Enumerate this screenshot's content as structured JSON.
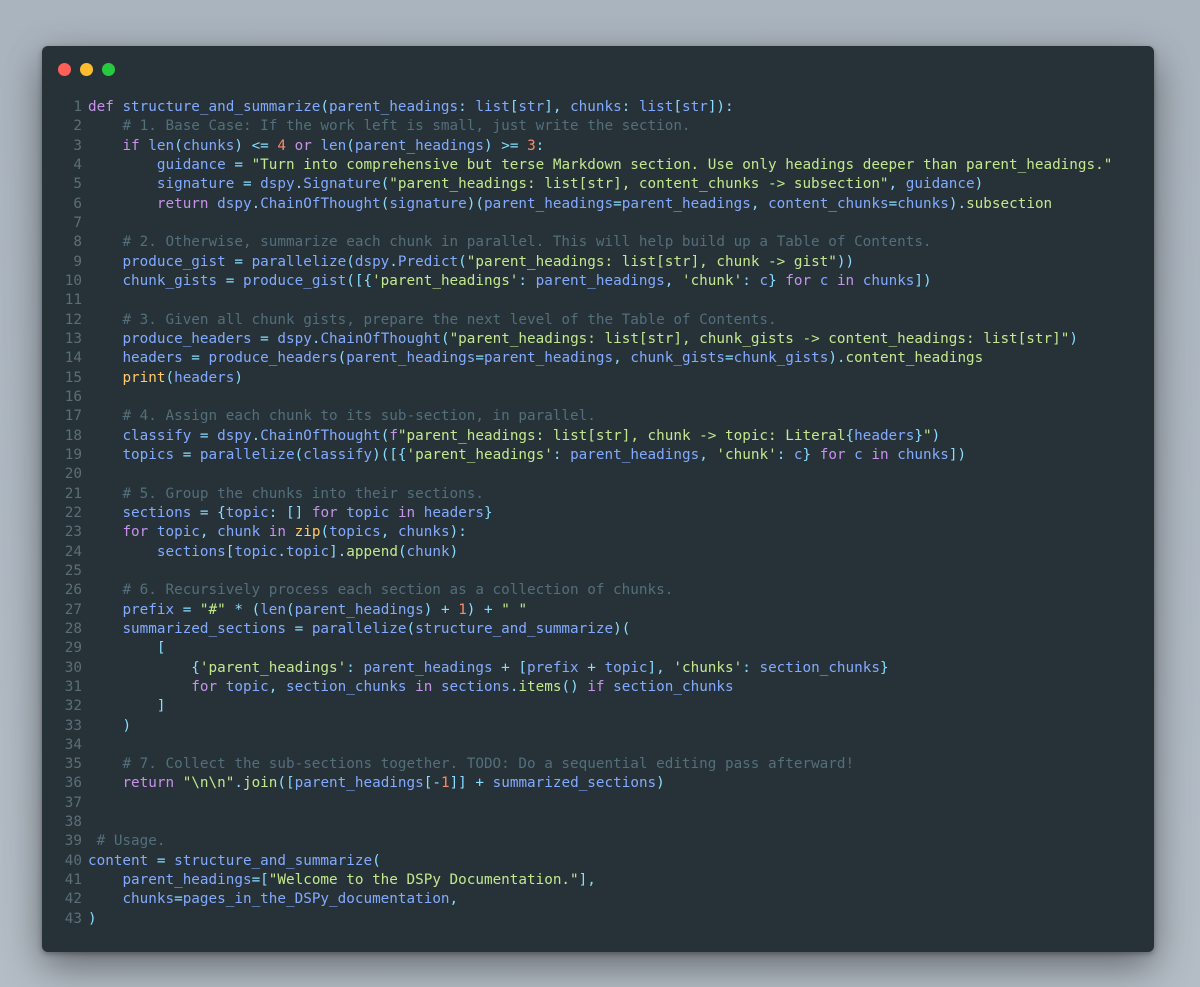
{
  "window": {
    "controls": [
      {
        "name": "close",
        "color": "#ff5f56"
      },
      {
        "name": "minimize",
        "color": "#ffbd2e"
      },
      {
        "name": "maximize",
        "color": "#27c93f"
      }
    ]
  },
  "code_lines": [
    [
      [
        "kw",
        "def "
      ],
      [
        "fn",
        "structure_and_summarize"
      ],
      [
        "pa",
        "("
      ],
      [
        "va",
        "parent_headings"
      ],
      [
        "op",
        ": "
      ],
      [
        "va",
        "list"
      ],
      [
        "pa",
        "["
      ],
      [
        "va",
        "str"
      ],
      [
        "pa",
        "], "
      ],
      [
        "va",
        "chunks"
      ],
      [
        "op",
        ": "
      ],
      [
        "va",
        "list"
      ],
      [
        "pa",
        "["
      ],
      [
        "va",
        "str"
      ],
      [
        "pa",
        "]):"
      ]
    ],
    [
      [
        "pl",
        "    "
      ],
      [
        "cm",
        "# 1. Base Case: If the work left is small, just write the section."
      ]
    ],
    [
      [
        "pl",
        "    "
      ],
      [
        "kw",
        "if "
      ],
      [
        "fn",
        "len"
      ],
      [
        "pa",
        "("
      ],
      [
        "va",
        "chunks"
      ],
      [
        "pa",
        ") "
      ],
      [
        "op",
        "<= "
      ],
      [
        "num",
        "4"
      ],
      [
        "kw",
        " or "
      ],
      [
        "fn",
        "len"
      ],
      [
        "pa",
        "("
      ],
      [
        "va",
        "parent_headings"
      ],
      [
        "pa",
        ") "
      ],
      [
        "op",
        ">= "
      ],
      [
        "num",
        "3"
      ],
      [
        "pa",
        ":"
      ]
    ],
    [
      [
        "pl",
        "        "
      ],
      [
        "va",
        "guidance"
      ],
      [
        "op",
        " = "
      ],
      [
        "str",
        "\"Turn into comprehensive but terse Markdown section. Use only headings deeper than parent_headings.\""
      ]
    ],
    [
      [
        "pl",
        "        "
      ],
      [
        "va",
        "signature"
      ],
      [
        "op",
        " = "
      ],
      [
        "va",
        "dspy"
      ],
      [
        "op",
        "."
      ],
      [
        "fn",
        "Signature"
      ],
      [
        "pa",
        "("
      ],
      [
        "str",
        "\"parent_headings: list[str], content_chunks -> subsection\""
      ],
      [
        "pa",
        ", "
      ],
      [
        "va",
        "guidance"
      ],
      [
        "pa",
        ")"
      ]
    ],
    [
      [
        "pl",
        "        "
      ],
      [
        "kw",
        "return "
      ],
      [
        "va",
        "dspy"
      ],
      [
        "op",
        "."
      ],
      [
        "fn",
        "ChainOfThought"
      ],
      [
        "pa",
        "("
      ],
      [
        "va",
        "signature"
      ],
      [
        "pa",
        ")("
      ],
      [
        "va",
        "parent_headings"
      ],
      [
        "op",
        "="
      ],
      [
        "va",
        "parent_headings"
      ],
      [
        "pa",
        ", "
      ],
      [
        "va",
        "content_chunks"
      ],
      [
        "op",
        "="
      ],
      [
        "va",
        "chunks"
      ],
      [
        "pa",
        ")."
      ],
      [
        "at",
        "subsection"
      ]
    ],
    [],
    [
      [
        "pl",
        "    "
      ],
      [
        "cm",
        "# 2. Otherwise, summarize each chunk in parallel. This will help build up a Table of Contents."
      ]
    ],
    [
      [
        "pl",
        "    "
      ],
      [
        "va",
        "produce_gist"
      ],
      [
        "op",
        " = "
      ],
      [
        "fn",
        "parallelize"
      ],
      [
        "pa",
        "("
      ],
      [
        "va",
        "dspy"
      ],
      [
        "op",
        "."
      ],
      [
        "fn",
        "Predict"
      ],
      [
        "pa",
        "("
      ],
      [
        "str",
        "\"parent_headings: list[str], chunk -> gist\""
      ],
      [
        "pa",
        "))"
      ]
    ],
    [
      [
        "pl",
        "    "
      ],
      [
        "va",
        "chunk_gists"
      ],
      [
        "op",
        " = "
      ],
      [
        "fn",
        "produce_gist"
      ],
      [
        "pa",
        "([{"
      ],
      [
        "str",
        "'parent_headings'"
      ],
      [
        "pa",
        ": "
      ],
      [
        "va",
        "parent_headings"
      ],
      [
        "pa",
        ", "
      ],
      [
        "str",
        "'chunk'"
      ],
      [
        "pa",
        ": "
      ],
      [
        "va",
        "c"
      ],
      [
        "pa",
        "} "
      ],
      [
        "kw",
        "for "
      ],
      [
        "va",
        "c "
      ],
      [
        "kw",
        "in "
      ],
      [
        "va",
        "chunks"
      ],
      [
        "pa",
        "])"
      ]
    ],
    [],
    [
      [
        "pl",
        "    "
      ],
      [
        "cm",
        "# 3. Given all chunk gists, prepare the next level of the Table of Contents."
      ]
    ],
    [
      [
        "pl",
        "    "
      ],
      [
        "va",
        "produce_headers"
      ],
      [
        "op",
        " = "
      ],
      [
        "va",
        "dspy"
      ],
      [
        "op",
        "."
      ],
      [
        "fn",
        "ChainOfThought"
      ],
      [
        "pa",
        "("
      ],
      [
        "str",
        "\"parent_headings: list[str], chunk_gists -> content_headings: list[str]\""
      ],
      [
        "pa",
        ")"
      ]
    ],
    [
      [
        "pl",
        "    "
      ],
      [
        "va",
        "headers"
      ],
      [
        "op",
        " = "
      ],
      [
        "fn",
        "produce_headers"
      ],
      [
        "pa",
        "("
      ],
      [
        "va",
        "parent_headings"
      ],
      [
        "op",
        "="
      ],
      [
        "va",
        "parent_headings"
      ],
      [
        "pa",
        ", "
      ],
      [
        "va",
        "chunk_gists"
      ],
      [
        "op",
        "="
      ],
      [
        "va",
        "chunk_gists"
      ],
      [
        "pa",
        ")."
      ],
      [
        "at",
        "content_headings"
      ]
    ],
    [
      [
        "pl",
        "    "
      ],
      [
        "ty",
        "print"
      ],
      [
        "pa",
        "("
      ],
      [
        "va",
        "headers"
      ],
      [
        "pa",
        ")"
      ]
    ],
    [],
    [
      [
        "pl",
        "    "
      ],
      [
        "cm",
        "# 4. Assign each chunk to its sub-section, in parallel."
      ]
    ],
    [
      [
        "pl",
        "    "
      ],
      [
        "va",
        "classify"
      ],
      [
        "op",
        " = "
      ],
      [
        "va",
        "dspy"
      ],
      [
        "op",
        "."
      ],
      [
        "fn",
        "ChainOfThought"
      ],
      [
        "pa",
        "("
      ],
      [
        "kw",
        "f"
      ],
      [
        "str",
        "\"parent_headings: list[str], chunk -> topic: Literal"
      ],
      [
        "op",
        "{"
      ],
      [
        "va",
        "headers"
      ],
      [
        "op",
        "}"
      ],
      [
        "str",
        "\""
      ],
      [
        "pa",
        ")"
      ]
    ],
    [
      [
        "pl",
        "    "
      ],
      [
        "va",
        "topics"
      ],
      [
        "op",
        " = "
      ],
      [
        "fn",
        "parallelize"
      ],
      [
        "pa",
        "("
      ],
      [
        "va",
        "classify"
      ],
      [
        "pa",
        ")([{"
      ],
      [
        "str",
        "'parent_headings'"
      ],
      [
        "pa",
        ": "
      ],
      [
        "va",
        "parent_headings"
      ],
      [
        "pa",
        ", "
      ],
      [
        "str",
        "'chunk'"
      ],
      [
        "pa",
        ": "
      ],
      [
        "va",
        "c"
      ],
      [
        "pa",
        "} "
      ],
      [
        "kw",
        "for "
      ],
      [
        "va",
        "c "
      ],
      [
        "kw",
        "in "
      ],
      [
        "va",
        "chunks"
      ],
      [
        "pa",
        "])"
      ]
    ],
    [],
    [
      [
        "pl",
        "    "
      ],
      [
        "cm",
        "# 5. Group the chunks into their sections."
      ]
    ],
    [
      [
        "pl",
        "    "
      ],
      [
        "va",
        "sections"
      ],
      [
        "op",
        " = "
      ],
      [
        "pa",
        "{"
      ],
      [
        "va",
        "topic"
      ],
      [
        "pa",
        ": [] "
      ],
      [
        "kw",
        "for "
      ],
      [
        "va",
        "topic "
      ],
      [
        "kw",
        "in "
      ],
      [
        "va",
        "headers"
      ],
      [
        "pa",
        "}"
      ]
    ],
    [
      [
        "pl",
        "    "
      ],
      [
        "kw",
        "for "
      ],
      [
        "va",
        "topic"
      ],
      [
        "pa",
        ", "
      ],
      [
        "va",
        "chunk "
      ],
      [
        "kw",
        "in "
      ],
      [
        "ty",
        "zip"
      ],
      [
        "pa",
        "("
      ],
      [
        "va",
        "topics"
      ],
      [
        "pa",
        ", "
      ],
      [
        "va",
        "chunks"
      ],
      [
        "pa",
        "):"
      ]
    ],
    [
      [
        "pl",
        "        "
      ],
      [
        "va",
        "sections"
      ],
      [
        "pa",
        "["
      ],
      [
        "va",
        "topic"
      ],
      [
        "op",
        "."
      ],
      [
        "va",
        "topic"
      ],
      [
        "pa",
        "]."
      ],
      [
        "at",
        "append"
      ],
      [
        "pa",
        "("
      ],
      [
        "va",
        "chunk"
      ],
      [
        "pa",
        ")"
      ]
    ],
    [],
    [
      [
        "pl",
        "    "
      ],
      [
        "cm",
        "# 6. Recursively process each section as a collection of chunks."
      ]
    ],
    [
      [
        "pl",
        "    "
      ],
      [
        "va",
        "prefix"
      ],
      [
        "op",
        " = "
      ],
      [
        "str",
        "\"#\""
      ],
      [
        "op",
        " * "
      ],
      [
        "pa",
        "("
      ],
      [
        "fn",
        "len"
      ],
      [
        "pa",
        "("
      ],
      [
        "va",
        "parent_headings"
      ],
      [
        "pa",
        ") "
      ],
      [
        "op",
        "+ "
      ],
      [
        "num",
        "1"
      ],
      [
        "pa",
        ") "
      ],
      [
        "op",
        "+ "
      ],
      [
        "str",
        "\" \""
      ]
    ],
    [
      [
        "pl",
        "    "
      ],
      [
        "va",
        "summarized_sections"
      ],
      [
        "op",
        " = "
      ],
      [
        "fn",
        "parallelize"
      ],
      [
        "pa",
        "("
      ],
      [
        "va",
        "structure_and_summarize"
      ],
      [
        "pa",
        ")("
      ]
    ],
    [
      [
        "pl",
        "        "
      ],
      [
        "pa",
        "["
      ]
    ],
    [
      [
        "pl",
        "            "
      ],
      [
        "pa",
        "{"
      ],
      [
        "str",
        "'parent_headings'"
      ],
      [
        "pa",
        ": "
      ],
      [
        "va",
        "parent_headings"
      ],
      [
        "op",
        " + "
      ],
      [
        "pa",
        "["
      ],
      [
        "va",
        "prefix"
      ],
      [
        "op",
        " + "
      ],
      [
        "va",
        "topic"
      ],
      [
        "pa",
        "], "
      ],
      [
        "str",
        "'chunks'"
      ],
      [
        "pa",
        ": "
      ],
      [
        "va",
        "section_chunks"
      ],
      [
        "pa",
        "}"
      ]
    ],
    [
      [
        "pl",
        "            "
      ],
      [
        "kw",
        "for "
      ],
      [
        "va",
        "topic"
      ],
      [
        "pa",
        ", "
      ],
      [
        "va",
        "section_chunks "
      ],
      [
        "kw",
        "in "
      ],
      [
        "va",
        "sections"
      ],
      [
        "op",
        "."
      ],
      [
        "at",
        "items"
      ],
      [
        "pa",
        "() "
      ],
      [
        "kw",
        "if "
      ],
      [
        "va",
        "section_chunks"
      ]
    ],
    [
      [
        "pl",
        "        "
      ],
      [
        "pa",
        "]"
      ]
    ],
    [
      [
        "pl",
        "    "
      ],
      [
        "pa",
        ")"
      ]
    ],
    [],
    [
      [
        "pl",
        "    "
      ],
      [
        "cm",
        "# 7. Collect the sub-sections together. TODO: Do a sequential editing pass afterward!"
      ]
    ],
    [
      [
        "pl",
        "    "
      ],
      [
        "kw",
        "return "
      ],
      [
        "str",
        "\"\\n\\n\""
      ],
      [
        "op",
        "."
      ],
      [
        "at",
        "join"
      ],
      [
        "pa",
        "(["
      ],
      [
        "va",
        "parent_headings"
      ],
      [
        "pa",
        "["
      ],
      [
        "op",
        "-"
      ],
      [
        "num",
        "1"
      ],
      [
        "pa",
        "]] "
      ],
      [
        "op",
        "+ "
      ],
      [
        "va",
        "summarized_sections"
      ],
      [
        "pa",
        ")"
      ]
    ],
    [],
    [],
    [
      [
        "pl",
        " "
      ],
      [
        "cm",
        "# Usage."
      ]
    ],
    [
      [
        "va",
        "content"
      ],
      [
        "op",
        " = "
      ],
      [
        "fn",
        "structure_and_summarize"
      ],
      [
        "pa",
        "("
      ]
    ],
    [
      [
        "pl",
        "    "
      ],
      [
        "va",
        "parent_headings"
      ],
      [
        "op",
        "="
      ],
      [
        "pa",
        "["
      ],
      [
        "str",
        "\"Welcome to the DSPy Documentation.\""
      ],
      [
        "pa",
        "],"
      ]
    ],
    [
      [
        "pl",
        "    "
      ],
      [
        "va",
        "chunks"
      ],
      [
        "op",
        "="
      ],
      [
        "va",
        "pages_in_the_DSPy_documentation"
      ],
      [
        "pa",
        ","
      ]
    ],
    [
      [
        "pa",
        ")"
      ]
    ]
  ]
}
